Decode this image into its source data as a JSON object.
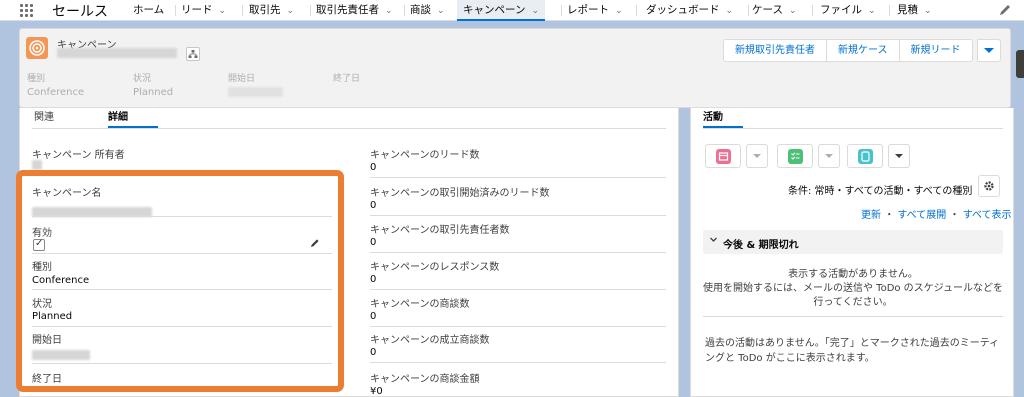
{
  "nav": {
    "app_name": "セールス",
    "tabs": [
      {
        "label": "ホーム",
        "dropdown": false
      },
      {
        "label": "リード",
        "dropdown": true
      },
      {
        "label": "取引先",
        "dropdown": true
      },
      {
        "label": "取引先責任者",
        "dropdown": true
      },
      {
        "label": "商談",
        "dropdown": true
      },
      {
        "label": "キャンペーン",
        "dropdown": true,
        "active": true
      },
      {
        "label": "レポート",
        "dropdown": true
      },
      {
        "label": "ダッシュボード",
        "dropdown": true
      },
      {
        "label": "ケース",
        "dropdown": true
      },
      {
        "label": "ファイル",
        "dropdown": true
      },
      {
        "label": "見積",
        "dropdown": true
      }
    ],
    "chevron": "⌄"
  },
  "header": {
    "object_type": "キャンペーン",
    "buttons": [
      "新規取引先責任者",
      "新規ケース",
      "新規リード"
    ],
    "fields": [
      {
        "label": "種別",
        "value": "Conference"
      },
      {
        "label": "状況",
        "value": "Planned"
      },
      {
        "label": "開始日",
        "value": ""
      },
      {
        "label": "終了日",
        "value": ""
      }
    ]
  },
  "detail": {
    "tabs": [
      "関連",
      "詳細"
    ],
    "left_fields": [
      {
        "label": "キャンペーン 所有者",
        "value": ""
      },
      {
        "label": "キャンペーン名",
        "value": ""
      },
      {
        "label": "有効",
        "value": "✓"
      },
      {
        "label": "種別",
        "value": "Conference"
      },
      {
        "label": "状況",
        "value": "Planned"
      },
      {
        "label": "開始日",
        "value": ""
      },
      {
        "label": "終了日",
        "value": ""
      }
    ],
    "right_fields": [
      {
        "label": "キャンペーンのリード数",
        "value": "0"
      },
      {
        "label": "キャンペーンの取引開始済みのリード数",
        "value": "0"
      },
      {
        "label": "キャンペーンの取引先責任者数",
        "value": "0"
      },
      {
        "label": "キャンペーンのレスポンス数",
        "value": "0"
      },
      {
        "label": "キャンペーンの商談数",
        "value": "0"
      },
      {
        "label": "キャンペーンの成立商談数",
        "value": "0"
      },
      {
        "label": "キャンペーンの商談金額",
        "value": "¥0"
      }
    ]
  },
  "activity": {
    "tab": "活動",
    "filter": "条件: 常時・すべての活動・すべての種別",
    "links": [
      "更新",
      "すべて展開",
      "すべて表示"
    ],
    "link_sep": "・",
    "section_title": "今後 & 期限切れ",
    "empty_lines": [
      "表示する活動がありません。",
      "使用を開始するには、メールの送信や ToDo のスケジュールなどを",
      "行ってください。"
    ],
    "past_lines": [
      "過去の活動はありません。「完了」とマークされた過去のミーティ",
      "ングと ToDo がここに表示されます。"
    ],
    "colors": {
      "event": "#eb7092",
      "task": "#4bc076",
      "call": "#48c3cc"
    }
  },
  "colors": {
    "brand": "#0070d2",
    "highlight": "#ed7d31",
    "campaign_icon": "#f49756"
  }
}
